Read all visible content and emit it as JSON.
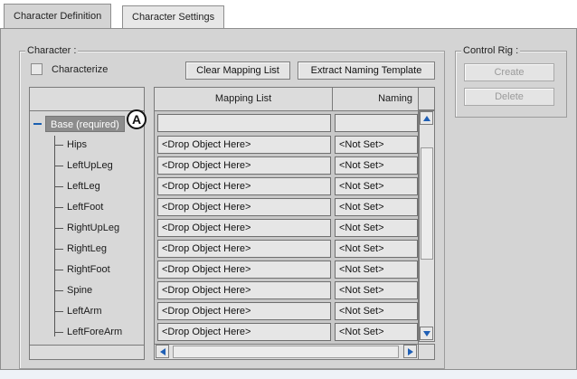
{
  "tabs": [
    {
      "label": "Character Definition",
      "active": true
    },
    {
      "label": "Character Settings",
      "active": false
    }
  ],
  "character_group": {
    "title": "Character :",
    "characterize_label": "Characterize",
    "characterize_checked": false,
    "clear_mapping_label": "Clear Mapping List",
    "extract_naming_label": "Extract Naming Template"
  },
  "tree": {
    "base_label": "Base (required)",
    "callout": "A",
    "nodes": [
      "Hips",
      "LeftUpLeg",
      "LeftLeg",
      "LeftFoot",
      "RightUpLeg",
      "RightLeg",
      "RightFoot",
      "Spine",
      "LeftArm",
      "LeftForeArm"
    ]
  },
  "grid": {
    "columns": [
      "Mapping List",
      "Naming"
    ],
    "rows": [
      {
        "mapping": "<Drop Object Here>",
        "naming": "<Not Set>"
      },
      {
        "mapping": "<Drop Object Here>",
        "naming": "<Not Set>"
      },
      {
        "mapping": "<Drop Object Here>",
        "naming": "<Not Set>"
      },
      {
        "mapping": "<Drop Object Here>",
        "naming": "<Not Set>"
      },
      {
        "mapping": "<Drop Object Here>",
        "naming": "<Not Set>"
      },
      {
        "mapping": "<Drop Object Here>",
        "naming": "<Not Set>"
      },
      {
        "mapping": "<Drop Object Here>",
        "naming": "<Not Set>"
      },
      {
        "mapping": "<Drop Object Here>",
        "naming": "<Not Set>"
      },
      {
        "mapping": "<Drop Object Here>",
        "naming": "<Not Set>"
      },
      {
        "mapping": "<Drop Object Here>",
        "naming": "<Not Set>"
      }
    ]
  },
  "control_rig": {
    "title": "Control Rig :",
    "create_label": "Create",
    "delete_label": "Delete"
  },
  "colors": {
    "panel_bg": "#d4d4d4",
    "accent_blue": "#1f5fb5",
    "selected_bg": "#8c8c8c"
  }
}
